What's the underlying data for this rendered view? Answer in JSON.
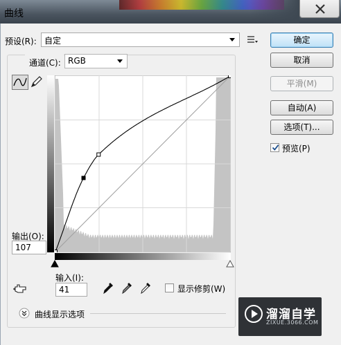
{
  "window": {
    "title": "曲线",
    "close_icon": "close-icon"
  },
  "preset": {
    "label": "预设(R):",
    "value": "自定"
  },
  "channel": {
    "label": "通道(C):",
    "value": "RGB"
  },
  "output": {
    "label": "输出(O):",
    "value": "107"
  },
  "input": {
    "label": "输入(I):",
    "value": "41"
  },
  "show_clipping": {
    "label": "显示修剪(W)",
    "checked": false
  },
  "curve_display_options": {
    "label": "曲线显示选项"
  },
  "buttons": {
    "ok": "确定",
    "cancel": "取消",
    "smooth": "平滑(M)",
    "auto": "自动(A)",
    "options": "选项(T)..."
  },
  "preview": {
    "label": "预览(P)",
    "checked": true
  },
  "curve": {
    "points": [
      [
        0,
        0
      ],
      [
        41,
        107
      ],
      [
        63,
        141
      ],
      [
        255,
        255
      ]
    ],
    "histogram_peaks": [
      "shadows",
      "highlights"
    ],
    "line_color": "#000000",
    "histogram_color": "#c4c4c4"
  },
  "watermark": {
    "name": "溜溜自学",
    "url": "ZIXUE.3066.COM"
  }
}
